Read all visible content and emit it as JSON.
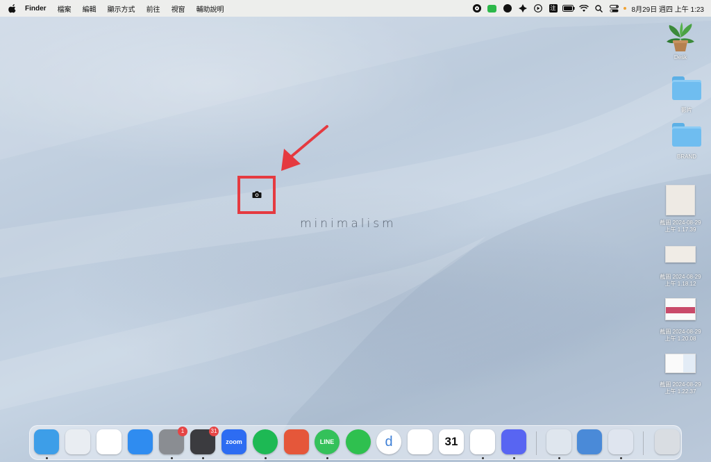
{
  "menubar": {
    "app_name": "Finder",
    "menus": [
      "檔案",
      "編輯",
      "顯示方式",
      "前往",
      "視窗",
      "輔助說明"
    ],
    "tray_icons": [
      "record-icon",
      "line-icon",
      "pastebot-icon",
      "scatter-icon",
      "play-icon",
      "input-method-icon",
      "battery-icon",
      "wifi-icon",
      "search-icon",
      "control-center-icon"
    ],
    "input_method_label": "注",
    "clock": "8月29日 週四 上午 1:23"
  },
  "desktop": {
    "watermark": "minimalism",
    "items": [
      {
        "label": "Desk",
        "kind": "plant"
      },
      {
        "label": "影片",
        "kind": "folder"
      },
      {
        "label": "BRAND",
        "kind": "folder"
      },
      {
        "label": "截圖 2024-08-29\n上午 1.17.39",
        "line1": "截圖 2024-08-29",
        "line2": "上午 1.17.39",
        "kind": "screenshot"
      },
      {
        "label": "截圖 2024-08-29 上午 1.18.12",
        "line1": "截圖 2024-08-29",
        "line2": "上午 1.18.12",
        "kind": "screenshot"
      },
      {
        "label": "截圖 2024-08-29 上午 1.20.08",
        "line1": "截圖 2024-08-29",
        "line2": "上午 1.20.08",
        "kind": "screenshot"
      },
      {
        "label": "截圖 2024-08-29 上午 1.22.37",
        "line1": "截圖 2024-08-29",
        "line2": "上午 1.22.37",
        "kind": "screenshot"
      }
    ]
  },
  "annotation": {
    "highlight_color": "#e53a40",
    "target_icon": "camera-icon"
  },
  "dock": {
    "apps": [
      {
        "name": "finder-icon",
        "badge": null,
        "running": true,
        "color": "#3d9ee8"
      },
      {
        "name": "launchpad-icon",
        "badge": null,
        "running": false,
        "color": "#e9edf2"
      },
      {
        "name": "chrome-icon",
        "badge": null,
        "running": false,
        "color": "#ffffff"
      },
      {
        "name": "app-store-icon",
        "badge": null,
        "running": false,
        "color": "#2f8cf0"
      },
      {
        "name": "system-settings-icon",
        "badge": "1",
        "running": true,
        "color": "#8a8d92"
      },
      {
        "name": "setapp-icon",
        "badge": "31",
        "running": true,
        "color": "#3b3b3f"
      },
      {
        "name": "zoom-icon",
        "badge": null,
        "running": false,
        "color": "#2d6cf2"
      },
      {
        "name": "spotify-icon",
        "badge": null,
        "running": true,
        "color": "#1db954"
      },
      {
        "name": "scatter-app-icon",
        "badge": null,
        "running": false,
        "color": "#e5573a"
      },
      {
        "name": "line-app-icon",
        "badge": null,
        "running": true,
        "color": "#34c15a"
      },
      {
        "name": "wechat-icon",
        "badge": null,
        "running": false,
        "color": "#2fc04f"
      },
      {
        "name": "dict-icon",
        "badge": null,
        "running": false,
        "color": "#ffffff"
      },
      {
        "name": "timing-icon",
        "badge": null,
        "running": false,
        "color": "#ffffff"
      },
      {
        "name": "calendar-icon",
        "badge": null,
        "running": false,
        "color": "#ffffff"
      },
      {
        "name": "affinity-icon",
        "badge": null,
        "running": true,
        "color": "#ffffff"
      },
      {
        "name": "discord-icon",
        "badge": null,
        "running": true,
        "color": "#5865f2"
      },
      {
        "name": "preview-icon",
        "badge": null,
        "running": true,
        "color": "#dfe6ee"
      },
      {
        "name": "screenshot-app-icon",
        "badge": null,
        "running": false,
        "color": "#4a8ad8"
      },
      {
        "name": "1password-icon",
        "badge": null,
        "running": true,
        "color": "#dfe5ef"
      },
      {
        "name": "trash-icon",
        "badge": null,
        "running": false,
        "color": "#d9dde2"
      }
    ],
    "zoom_label": "zoom",
    "line_label": "LINE",
    "calendar_day": "31",
    "dict_label": "d"
  }
}
